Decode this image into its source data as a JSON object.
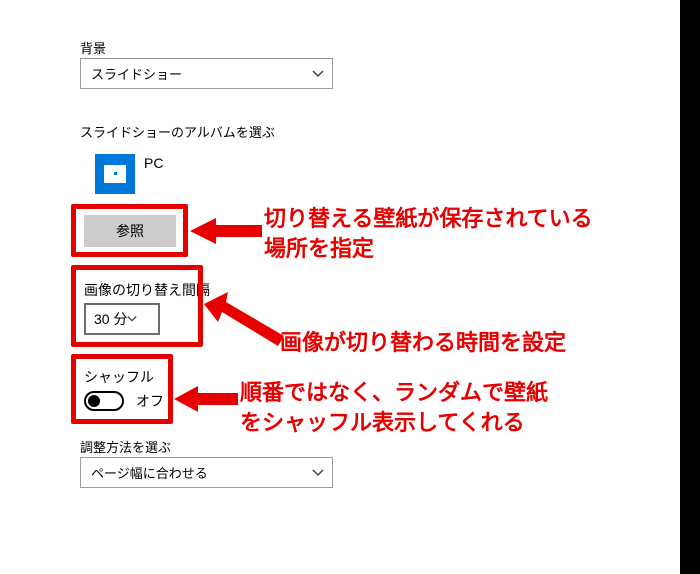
{
  "background": {
    "label": "背景",
    "value": "スライドショー"
  },
  "album": {
    "label": "スライドショーのアルバムを選ぶ",
    "folder_name": "PC",
    "browse_label": "参照"
  },
  "interval": {
    "label": "画像の切り替え間隔",
    "value": "30 分"
  },
  "shuffle": {
    "label": "シャッフル",
    "state_label": "オフ",
    "state": false
  },
  "fit": {
    "label": "調整方法を選ぶ",
    "value": "ページ幅に合わせる"
  },
  "annotations": {
    "browse": "切り替える壁紙が保存されている\n場所を指定",
    "interval": "画像が切り替わる時間を設定",
    "shuffle": "順番ではなく、ランダムで壁紙\nをシャッフル表示してくれる"
  },
  "colors": {
    "accent": "#0078d7",
    "highlight": "#e60000"
  }
}
